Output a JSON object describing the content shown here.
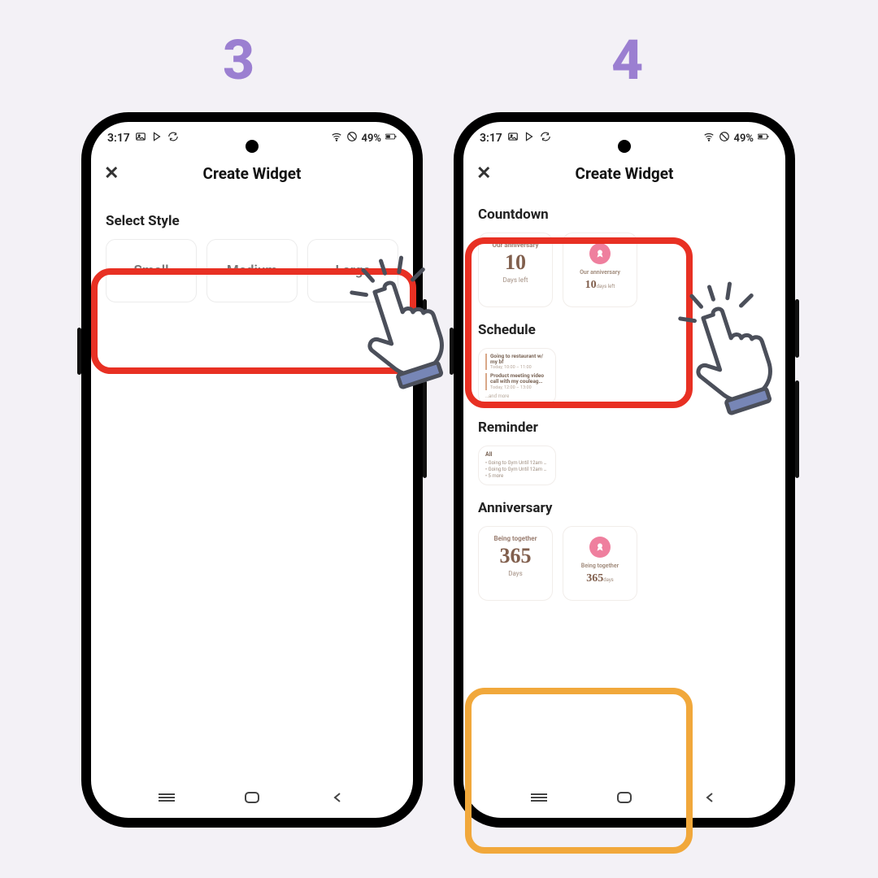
{
  "steps": {
    "three": "3",
    "four": "4"
  },
  "status": {
    "time": "3:17",
    "battery": "49%"
  },
  "title": "Create Widget",
  "phone3": {
    "section": "Select Style",
    "sizes": [
      "Small",
      "Medium",
      "Large"
    ]
  },
  "phone4": {
    "countdown": {
      "heading": "Countdown",
      "card1": {
        "title": "Our anniversary",
        "num": "10",
        "sub": "Days left"
      },
      "card2": {
        "title": "Our anniversary",
        "num": "10",
        "suffix": "days left"
      }
    },
    "schedule": {
      "heading": "Schedule",
      "items": [
        {
          "t": "Going to restaurant w/ my bf",
          "s": "Today, 10:00 – 11:00"
        },
        {
          "t": "Product meeting video call with my couleag…",
          "s": "Today, 12:00 – 13:00"
        }
      ],
      "more": "…and more"
    },
    "reminder": {
      "heading": "Reminder",
      "head": "All",
      "items": [
        "Going to Gym Until 12am …",
        "Going to Gym Until 12am …",
        "5 more"
      ]
    },
    "anniversary": {
      "heading": "Anniversary",
      "card1": {
        "title": "Being together",
        "num": "365",
        "sub": "Days"
      },
      "card2": {
        "title": "Being together",
        "num": "365",
        "suffix": "days"
      }
    }
  },
  "colors": {
    "accent_purple": "#9b7fd1",
    "highlight_red": "#e83023",
    "highlight_orange": "#f1a83b",
    "rose": "#ef7f9e"
  }
}
